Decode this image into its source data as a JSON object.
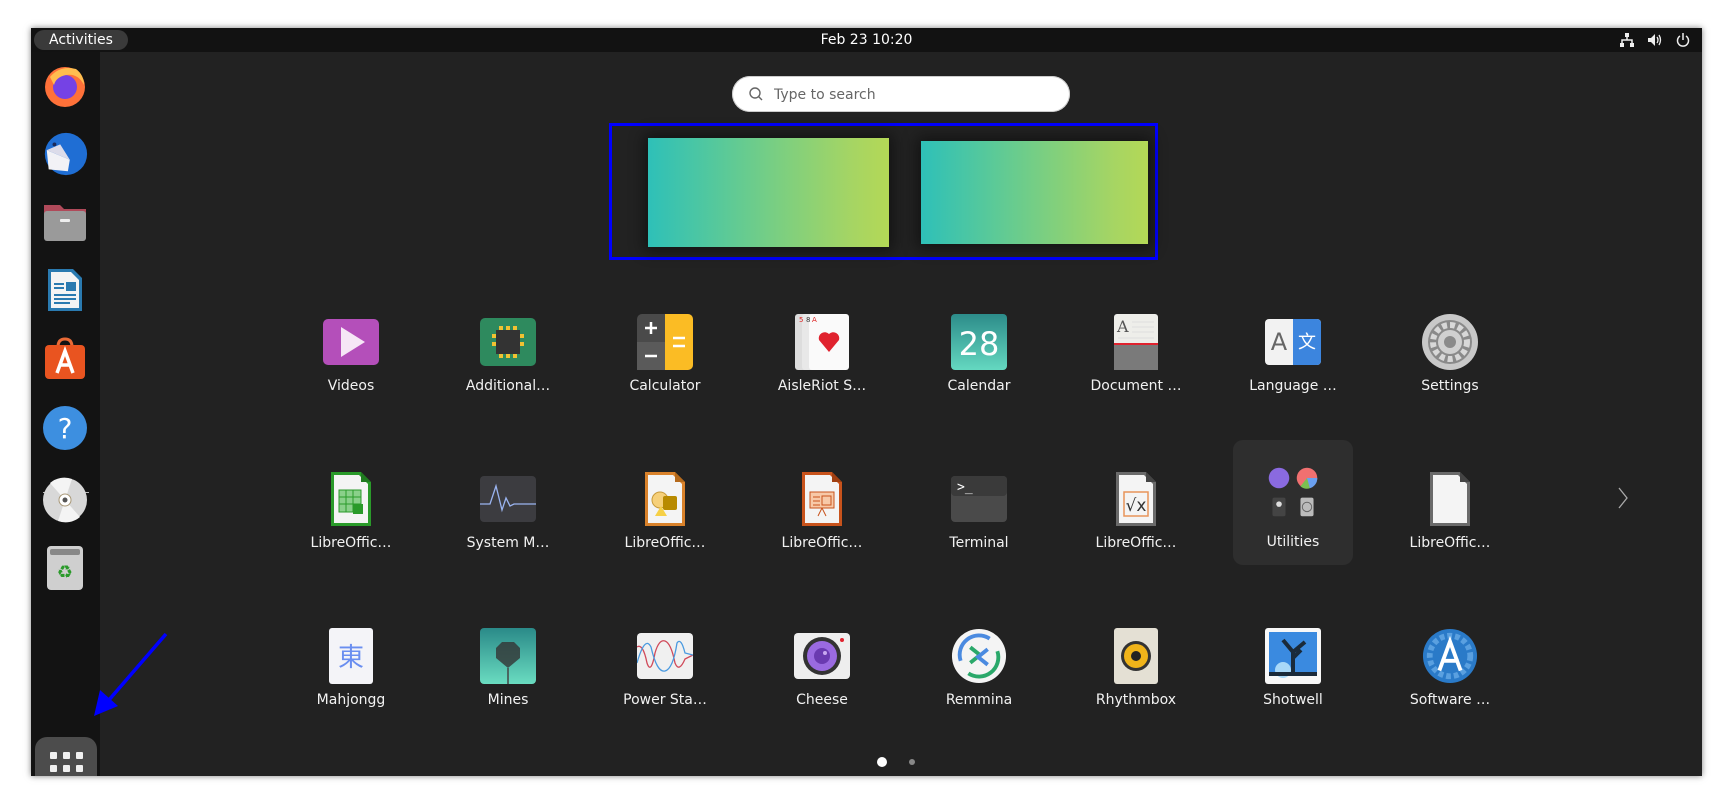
{
  "topbar": {
    "activities_label": "Activities",
    "clock": "Feb 23  10:20",
    "tray_icons": [
      "network-icon",
      "volume-icon",
      "power-icon"
    ]
  },
  "dock": {
    "items": [
      {
        "name": "Firefox",
        "icon": "firefox-icon"
      },
      {
        "name": "Thunderbird",
        "icon": "thunderbird-icon"
      },
      {
        "name": "Files",
        "icon": "files-icon"
      },
      {
        "name": "LibreOffice Writer",
        "icon": "libreoffice-writer-icon"
      },
      {
        "name": "Ubuntu Software",
        "icon": "app-center-icon"
      },
      {
        "name": "Help",
        "icon": "help-icon"
      },
      {
        "name": "Disc",
        "icon": "disc-icon"
      },
      {
        "name": "Trash",
        "icon": "trash-icon"
      }
    ],
    "show_apps_icon": "show-apps-grid-icon"
  },
  "search": {
    "placeholder": "Type to search",
    "value": ""
  },
  "workspaces": {
    "count": 2,
    "highlight_color": "#0000ff"
  },
  "apps": {
    "rows": [
      [
        {
          "label": "Videos",
          "icon": "videos-icon"
        },
        {
          "label": "Additional…",
          "icon": "additional-drivers-icon"
        },
        {
          "label": "Calculator",
          "icon": "calculator-icon"
        },
        {
          "label": "AisleRiot S…",
          "icon": "aisleriot-icon"
        },
        {
          "label": "Calendar",
          "icon": "calendar-icon",
          "day": "28"
        },
        {
          "label": "Document …",
          "icon": "document-scanner-icon"
        },
        {
          "label": "Language …",
          "icon": "language-support-icon"
        },
        {
          "label": "Settings",
          "icon": "settings-icon"
        }
      ],
      [
        {
          "label": "LibreOffic…",
          "icon": "libreoffice-calc-icon"
        },
        {
          "label": "System M…",
          "icon": "system-monitor-icon"
        },
        {
          "label": "LibreOffic…",
          "icon": "libreoffice-draw-icon"
        },
        {
          "label": "LibreOffic…",
          "icon": "libreoffice-impress-icon"
        },
        {
          "label": "Terminal",
          "icon": "terminal-icon"
        },
        {
          "label": "LibreOffic…",
          "icon": "libreoffice-math-icon"
        },
        {
          "label": "Utilities",
          "icon": "utilities-folder-icon"
        },
        {
          "label": "LibreOffic…",
          "icon": "libreoffice-icon"
        }
      ],
      [
        {
          "label": "Mahjongg",
          "icon": "mahjongg-icon",
          "glyph": "東"
        },
        {
          "label": "Mines",
          "icon": "mines-icon"
        },
        {
          "label": "Power Sta…",
          "icon": "power-statistics-icon"
        },
        {
          "label": "Cheese",
          "icon": "cheese-icon"
        },
        {
          "label": "Remmina",
          "icon": "remmina-icon"
        },
        {
          "label": "Rhythmbox",
          "icon": "rhythmbox-icon"
        },
        {
          "label": "Shotwell",
          "icon": "shotwell-icon"
        },
        {
          "label": "Software …",
          "icon": "software-updater-icon"
        }
      ]
    ]
  },
  "pagination": {
    "pages": 2,
    "current": 1
  },
  "annotation": {
    "arrow_color": "#0000ff"
  }
}
